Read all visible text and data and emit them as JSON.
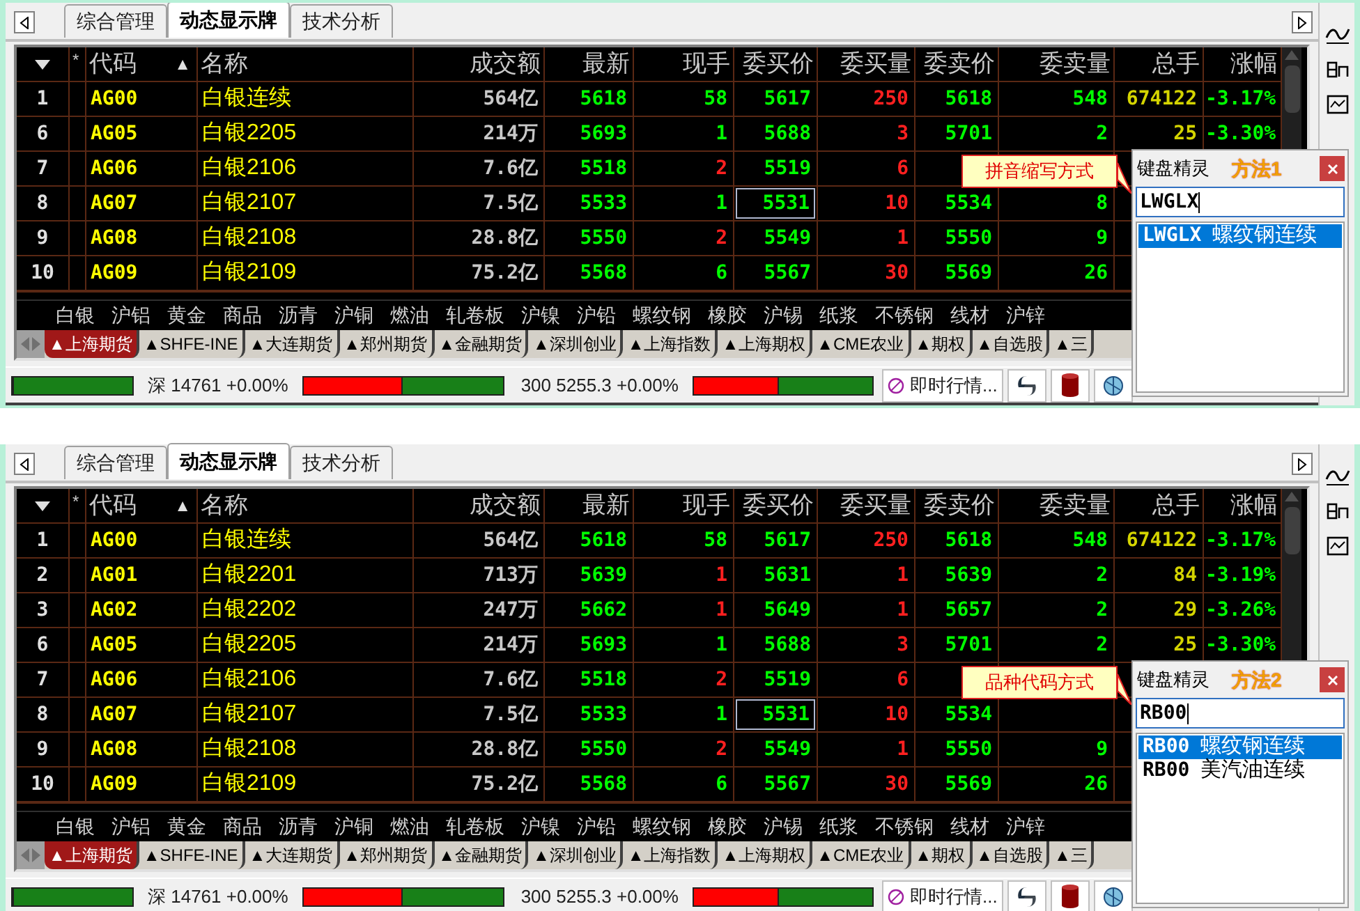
{
  "panels": [
    {
      "view_tabs": [
        {
          "label": "综合管理",
          "selected": false
        },
        {
          "label": "动态显示牌",
          "selected": true
        },
        {
          "label": "技术分析",
          "selected": false
        }
      ],
      "columns": [
        {
          "label": "*"
        },
        {
          "label": "代码",
          "sort_mark": "▲"
        },
        {
          "label": "名称"
        },
        {
          "label": "成交额"
        },
        {
          "label": "最新"
        },
        {
          "label": "现手"
        },
        {
          "label": "委买价"
        },
        {
          "label": "委买量"
        },
        {
          "label": "委卖价"
        },
        {
          "label": "委卖量"
        },
        {
          "label": "总手"
        },
        {
          "label": "涨幅"
        }
      ],
      "rows": [
        {
          "no": "1",
          "code": "AG00",
          "name": "白银连续",
          "amount": "564亿",
          "last": "5618",
          "volume": {
            "text": "58",
            "color": "#00ff00"
          },
          "bid": "5617",
          "bid_vol": "250",
          "ask": "5618",
          "ask_vol": "548",
          "total": "674122",
          "change": "-3.17%",
          "selected": false
        },
        {
          "no": "6",
          "code": "AG05",
          "name": "白银2205",
          "amount": "214万",
          "last": "5693",
          "volume": {
            "text": "1",
            "color": "#00ff00"
          },
          "bid": "5688",
          "bid_vol": "3",
          "ask": "5701",
          "ask_vol": "2",
          "total": "25",
          "change": "-3.30%",
          "selected": false
        },
        {
          "no": "7",
          "code": "AG06",
          "name": "白银2106",
          "amount": "7.6亿",
          "last": "5518",
          "volume": {
            "text": "2",
            "color": "#ff2020"
          },
          "bid": "5519",
          "bid_vol": "6",
          "selected": false
        },
        {
          "no": "8",
          "code": "AG07",
          "name": "白银2107",
          "amount": "7.5亿",
          "last": "5533",
          "volume": {
            "text": "1",
            "color": "#00ff00"
          },
          "bid": "5531",
          "bid_vol": "10",
          "ask": "5534",
          "ask_vol": "8",
          "selected": true
        },
        {
          "no": "9",
          "code": "AG08",
          "name": "白银2108",
          "amount": "28.8亿",
          "last": "5550",
          "volume": {
            "text": "2",
            "color": "#ff2020"
          },
          "bid": "5549",
          "bid_vol": "1",
          "ask": "5550",
          "ask_vol": "9",
          "selected": false
        },
        {
          "no": "10",
          "code": "AG09",
          "name": "白银2109",
          "amount": "75.2亿",
          "last": "5568",
          "volume": {
            "text": "6",
            "color": "#00ff00"
          },
          "bid": "5567",
          "bid_vol": "30",
          "ask": "5569",
          "ask_vol": "26",
          "selected": false
        }
      ],
      "categories": [
        "白银",
        "沪铝",
        "黄金",
        "商品",
        "沥青",
        "沪铜",
        "燃油",
        "轧卷板",
        "沪镍",
        "沪铅",
        "螺纹钢",
        "橡胶",
        "沪锡",
        "纸浆",
        "不锈钢",
        "线材",
        "沪锌"
      ],
      "exchange_tabs": [
        {
          "label": "▲上海期货",
          "selected": true
        },
        {
          "label": "▲SHFE-INE",
          "selected": false
        },
        {
          "label": "▲大连期货",
          "selected": false
        },
        {
          "label": "▲郑州期货",
          "selected": false
        },
        {
          "label": "▲金融期货",
          "selected": false
        },
        {
          "label": "▲深圳创业",
          "selected": false
        },
        {
          "label": "▲上海指数",
          "selected": false
        },
        {
          "label": "▲上海期权",
          "selected": false
        },
        {
          "label": "▲CME农业",
          "selected": false
        },
        {
          "label": "▲期权",
          "selected": false
        },
        {
          "label": "▲自选股",
          "selected": false
        },
        {
          "label": "▲三",
          "selected": false
        }
      ],
      "status_bar": {
        "meters": [
          {
            "level": 0
          },
          {
            "level": 0.5
          },
          {
            "level": 0.48
          }
        ],
        "index_1": "深 14761 +0.00%",
        "index_2": "300 5255.3 +0.00%",
        "quote_button": "即时行情..."
      },
      "keyboard_wizard": {
        "title": "键盘精灵",
        "method": "方法1",
        "input": "LWGLX",
        "results": [
          {
            "code": "LWGLX",
            "name": "螺纹钢连续",
            "selected": true
          }
        ],
        "callout": "拼音缩写方式"
      }
    },
    {
      "view_tabs": [
        {
          "label": "综合管理",
          "selected": false
        },
        {
          "label": "动态显示牌",
          "selected": true
        },
        {
          "label": "技术分析",
          "selected": false
        }
      ],
      "columns": [
        {
          "label": "*"
        },
        {
          "label": "代码",
          "sort_mark": "▲"
        },
        {
          "label": "名称"
        },
        {
          "label": "成交额"
        },
        {
          "label": "最新"
        },
        {
          "label": "现手"
        },
        {
          "label": "委买价"
        },
        {
          "label": "委买量"
        },
        {
          "label": "委卖价"
        },
        {
          "label": "委卖量"
        },
        {
          "label": "总手"
        },
        {
          "label": "涨幅"
        }
      ],
      "rows": [
        {
          "no": "1",
          "code": "AG00",
          "name": "白银连续",
          "amount": "564亿",
          "last": "5618",
          "volume": {
            "text": "58",
            "color": "#00ff00"
          },
          "bid": "5617",
          "bid_vol": "250",
          "ask": "5618",
          "ask_vol": "548",
          "total": "674122",
          "change": "-3.17%",
          "selected": false
        },
        {
          "no": "2",
          "code": "AG01",
          "name": "白银2201",
          "amount": "713万",
          "last": "5639",
          "volume": {
            "text": "1",
            "color": "#ff2020"
          },
          "bid": "5631",
          "bid_vol": "1",
          "ask": "5639",
          "ask_vol": "2",
          "total": "84",
          "change": "-3.19%",
          "selected": false
        },
        {
          "no": "3",
          "code": "AG02",
          "name": "白银2202",
          "amount": "247万",
          "last": "5662",
          "volume": {
            "text": "1",
            "color": "#ff2020"
          },
          "bid": "5649",
          "bid_vol": "1",
          "ask": "5657",
          "ask_vol": "2",
          "total": "29",
          "change": "-3.26%",
          "selected": false
        },
        {
          "no": "6",
          "code": "AG05",
          "name": "白银2205",
          "amount": "214万",
          "last": "5693",
          "volume": {
            "text": "1",
            "color": "#00ff00"
          },
          "bid": "5688",
          "bid_vol": "3",
          "ask": "5701",
          "ask_vol": "2",
          "total": "25",
          "change": "-3.30%",
          "selected": false
        },
        {
          "no": "7",
          "code": "AG06",
          "name": "白银2106",
          "amount": "7.6亿",
          "last": "5518",
          "volume": {
            "text": "2",
            "color": "#ff2020"
          },
          "bid": "5519",
          "bid_vol": "6",
          "selected": false
        },
        {
          "no": "8",
          "code": "AG07",
          "name": "白银2107",
          "amount": "7.5亿",
          "last": "5533",
          "volume": {
            "text": "1",
            "color": "#00ff00"
          },
          "bid": "5531",
          "bid_vol": "10",
          "ask": "5534",
          "selected": true
        },
        {
          "no": "9",
          "code": "AG08",
          "name": "白银2108",
          "amount": "28.8亿",
          "last": "5550",
          "volume": {
            "text": "2",
            "color": "#ff2020"
          },
          "bid": "5549",
          "bid_vol": "1",
          "ask": "5550",
          "ask_vol": "9",
          "selected": false
        },
        {
          "no": "10",
          "code": "AG09",
          "name": "白银2109",
          "amount": "75.2亿",
          "last": "5568",
          "volume": {
            "text": "6",
            "color": "#00ff00"
          },
          "bid": "5567",
          "bid_vol": "30",
          "ask": "5569",
          "ask_vol": "26",
          "selected": false
        }
      ],
      "categories": [
        "白银",
        "沪铝",
        "黄金",
        "商品",
        "沥青",
        "沪铜",
        "燃油",
        "轧卷板",
        "沪镍",
        "沪铅",
        "螺纹钢",
        "橡胶",
        "沪锡",
        "纸浆",
        "不锈钢",
        "线材",
        "沪锌"
      ],
      "exchange_tabs": [
        {
          "label": "▲上海期货",
          "selected": true
        },
        {
          "label": "▲SHFE-INE",
          "selected": false
        },
        {
          "label": "▲大连期货",
          "selected": false
        },
        {
          "label": "▲郑州期货",
          "selected": false
        },
        {
          "label": "▲金融期货",
          "selected": false
        },
        {
          "label": "▲深圳创业",
          "selected": false
        },
        {
          "label": "▲上海指数",
          "selected": false
        },
        {
          "label": "▲上海期权",
          "selected": false
        },
        {
          "label": "▲CME农业",
          "selected": false
        },
        {
          "label": "▲期权",
          "selected": false
        },
        {
          "label": "▲自选股",
          "selected": false
        },
        {
          "label": "▲三",
          "selected": false
        }
      ],
      "status_bar": {
        "meters": [
          {
            "level": 0
          },
          {
            "level": 0.5
          },
          {
            "level": 0.48
          }
        ],
        "index_1": "深 14761 +0.00%",
        "index_2": "300 5255.3 +0.00%",
        "quote_button": "即时行情..."
      },
      "keyboard_wizard": {
        "title": "键盘精灵",
        "method": "方法2",
        "input": "RB00",
        "results": [
          {
            "code": "RB00",
            "name": "螺纹钢连续",
            "selected": true
          },
          {
            "code": "RB00",
            "name": "美汽油连续",
            "selected": false
          }
        ],
        "callout": "品种代码方式"
      }
    }
  ]
}
